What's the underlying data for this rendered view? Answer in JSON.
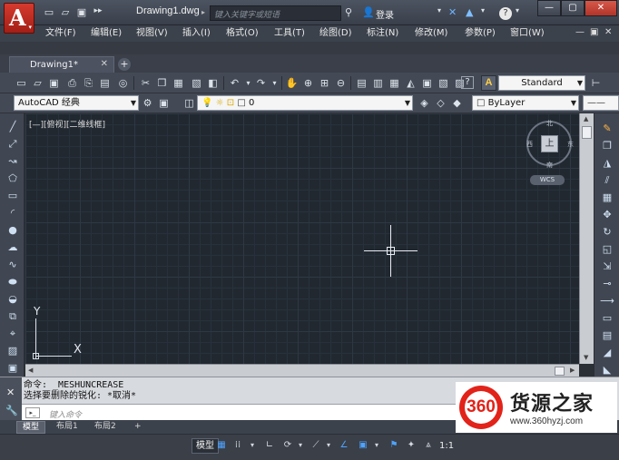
{
  "window": {
    "document_title": "Drawing1.dwg",
    "search_placeholder": "键入关键字或短语",
    "login_label": "登录",
    "minimize_glyph": "—",
    "restore_glyph": "▢",
    "close_glyph": "✕"
  },
  "menu": {
    "items": [
      "文件(F)",
      "编辑(E)",
      "视图(V)",
      "插入(I)",
      "格式(O)",
      "工具(T)",
      "绘图(D)",
      "标注(N)",
      "修改(M)",
      "参数(P)",
      "窗口(W)"
    ]
  },
  "tabs": {
    "active_doc": "Drawing1*",
    "close_glyph": "✕",
    "add_glyph": "+"
  },
  "toolbar": {
    "text_style_value": "Standard",
    "workspace_value": "AutoCAD 经典",
    "layer_value": "0",
    "color_value": "ByLayer"
  },
  "canvas": {
    "viewport_label": "[—][俯视][二维线框]",
    "viewcube_face": "上",
    "compass": {
      "n": "北",
      "s": "南",
      "w": "西",
      "e": "东"
    },
    "wcs_label": "WCS",
    "ucs_x": "X",
    "ucs_y": "Y"
  },
  "command": {
    "history": [
      "命令: _MESHUNCREASE",
      "选择要删除的锐化: *取消*"
    ],
    "input_placeholder": "键入命令"
  },
  "layouts": {
    "tabs": [
      "模型",
      "布局1",
      "布局2"
    ],
    "add_glyph": "+"
  },
  "status": {
    "model_label": "模型",
    "scale": "1:1"
  },
  "watermark": {
    "logo_text": "360",
    "brand_text": "货源之家",
    "url": "www.360hyzj.com"
  },
  "colors": {
    "accent_red": "#d63a2e",
    "canvas_bg": "#212830",
    "status_on": "#4ea3ff"
  }
}
